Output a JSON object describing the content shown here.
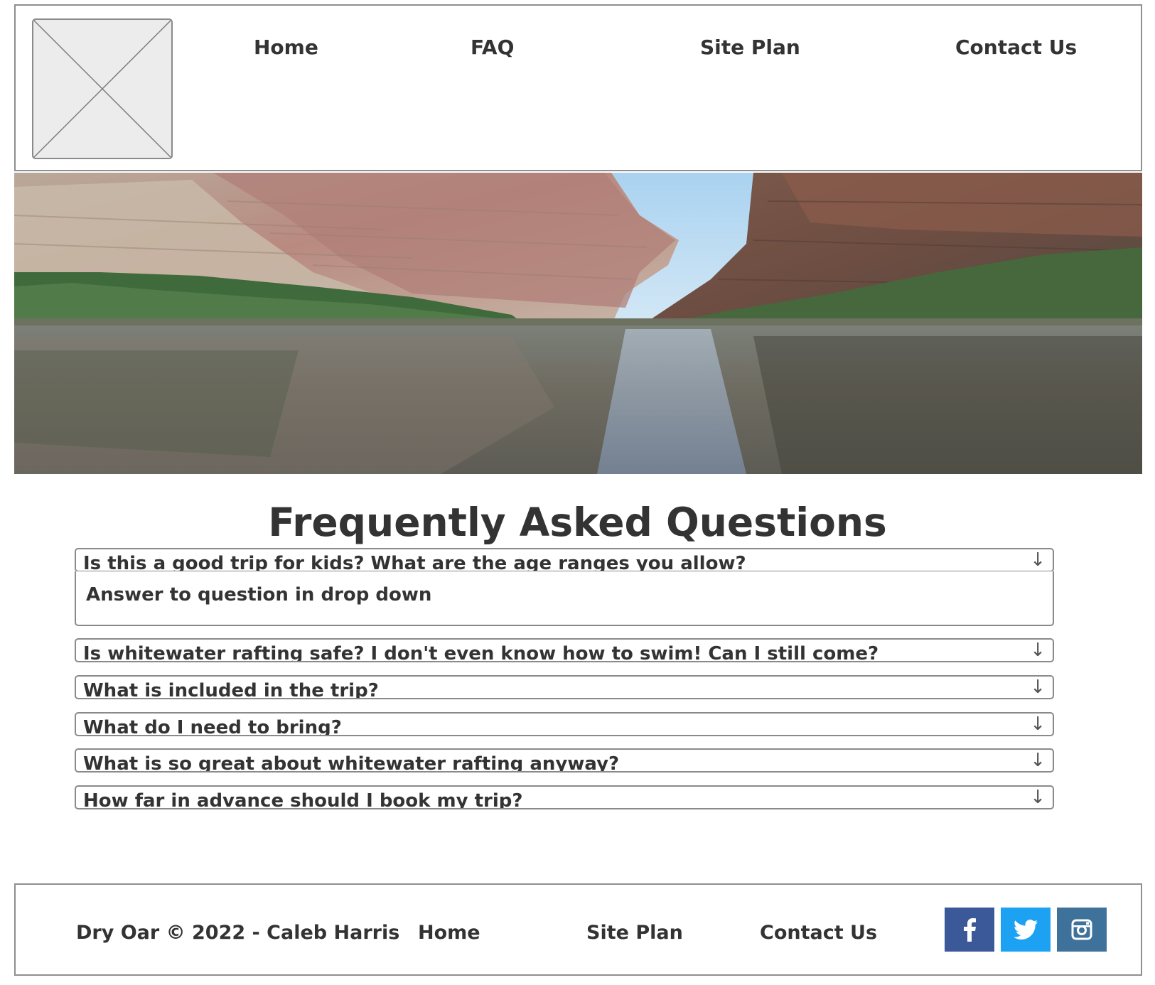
{
  "header": {
    "logo_alt": "",
    "nav": [
      {
        "label": "Home"
      },
      {
        "label": "FAQ"
      },
      {
        "label": "Site Plan"
      },
      {
        "label": "Contact Us"
      }
    ]
  },
  "faq": {
    "title": "Frequently Asked Questions",
    "items": [
      {
        "question": "Is this a good trip for kids? What are the age ranges you allow?",
        "expanded": true,
        "answer": "Answer to question in drop down"
      },
      {
        "question": "Is whitewater rafting safe? I don't even know how to swim! Can I still come?",
        "expanded": false
      },
      {
        "question": "What is included in the trip?",
        "expanded": false
      },
      {
        "question": "What do I need to bring?",
        "expanded": false
      },
      {
        "question": "What is so great about whitewater rafting anyway?",
        "expanded": false
      },
      {
        "question": "How far in advance should I book my trip?",
        "expanded": false
      }
    ],
    "toggle_icon": "↓"
  },
  "footer": {
    "copyright": "Dry Oar © 2022 - Caleb Harris",
    "links": [
      {
        "label": "Home"
      },
      {
        "label": "Site Plan"
      },
      {
        "label": "Contact Us"
      }
    ],
    "social": [
      {
        "name": "facebook-icon",
        "color": "#3b5998"
      },
      {
        "name": "twitter-icon",
        "color": "#1da1f2"
      },
      {
        "name": "instagram-icon",
        "color": "#3f729b"
      }
    ]
  }
}
